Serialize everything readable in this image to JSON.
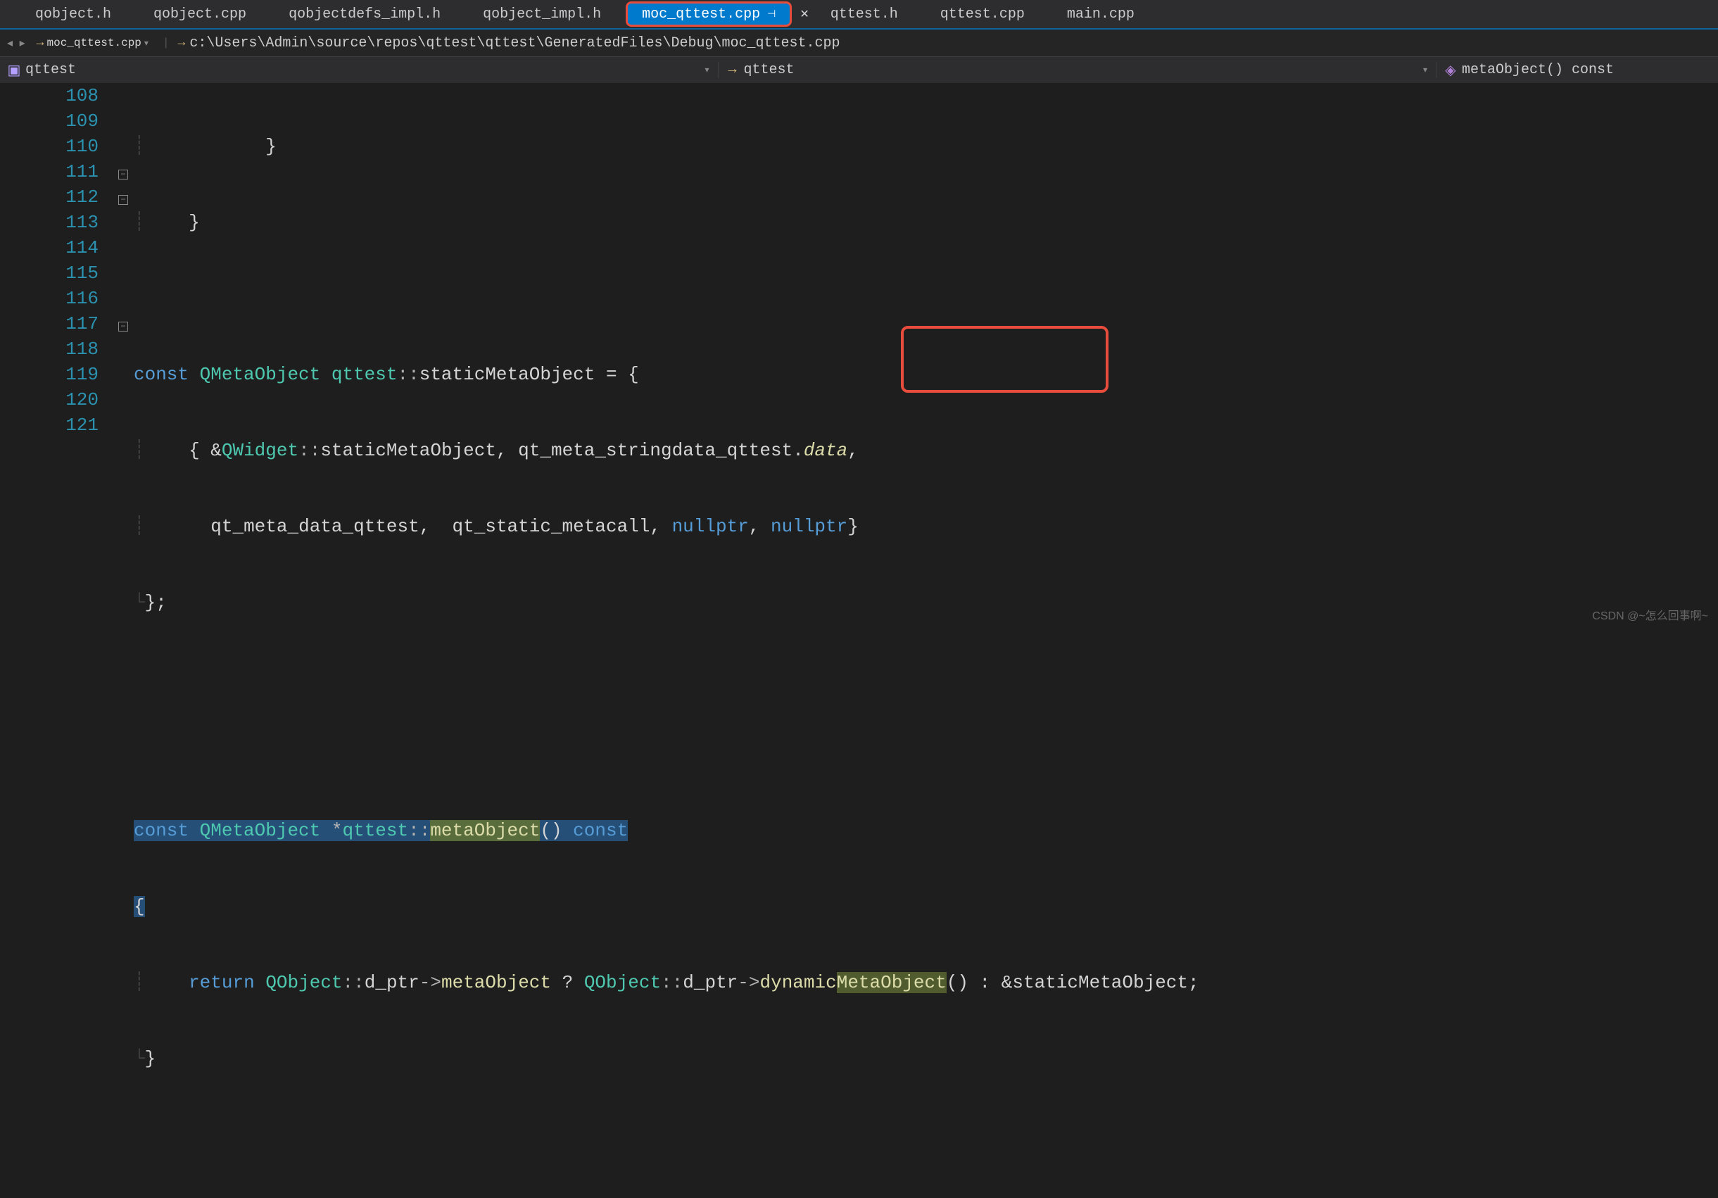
{
  "tabs": [
    {
      "label": "qobject.h"
    },
    {
      "label": "qobject.cpp"
    },
    {
      "label": "qobjectdefs_impl.h"
    },
    {
      "label": "qobject_impl.h"
    },
    {
      "label": "moc_qttest.cpp",
      "active": true,
      "pinned": true
    },
    {
      "label": "qttest.h"
    },
    {
      "label": "qttest.cpp"
    },
    {
      "label": "main.cpp"
    }
  ],
  "nav": {
    "file": "moc_qttest.cpp",
    "path": "c:\\Users\\Admin\\source\\repos\\qttest\\qttest\\GeneratedFiles\\Debug\\moc_qttest.cpp"
  },
  "context": {
    "scope1": "qttest",
    "scope2": "qttest",
    "symbol": "metaObject() const"
  },
  "lines": {
    "start": 108,
    "numbers": [
      "108",
      "109",
      "110",
      "111",
      "112",
      "113",
      "114",
      "115",
      "116",
      "117",
      "118",
      "119",
      "120",
      "121"
    ]
  },
  "code": {
    "l108": "        }",
    "l109": "    }",
    "l111_kw": "const",
    "l111_type": "QMetaObject",
    "l111_class": "qttest",
    "l111_member": "staticMetaObject",
    "l111_tail": " = {",
    "l112_a": "    { &",
    "l112_qwidget": "QWidget",
    "l112_smo": "staticMetaObject",
    "l112_c": ", qt_meta_stringdata_qttest.",
    "l112_data": "data",
    "l112_end": ",",
    "l113": "      qt_meta_data_qttest,  qt_static_metacall, ",
    "l113_null1": "nullptr",
    "l113_mid": ", ",
    "l113_null2": "nullptr",
    "l113_end": "}",
    "l114": "};",
    "l117_kw": "const",
    "l117_type": "QMetaObject",
    "l117_ptr": "*",
    "l117_class": "qttest",
    "l117_func": "metaObject",
    "l117_const": "const",
    "l118": "{",
    "l119_ret": "return",
    "l119_qo1": "QObject",
    "l119_dptr1": "d_ptr",
    "l119_mo": "metaObject",
    "l119_q": " ? ",
    "l119_qo2": "QObject",
    "l119_dptr2": "d_ptr",
    "l119_dyn": "dynamic",
    "l119_meta": "MetaObject",
    "l119_tail": "() : &",
    "l119_smo": "staticMetaObject",
    "l119_semi": ";",
    "l120": "}"
  },
  "watermark": "CSDN @~怎么回事啊~"
}
